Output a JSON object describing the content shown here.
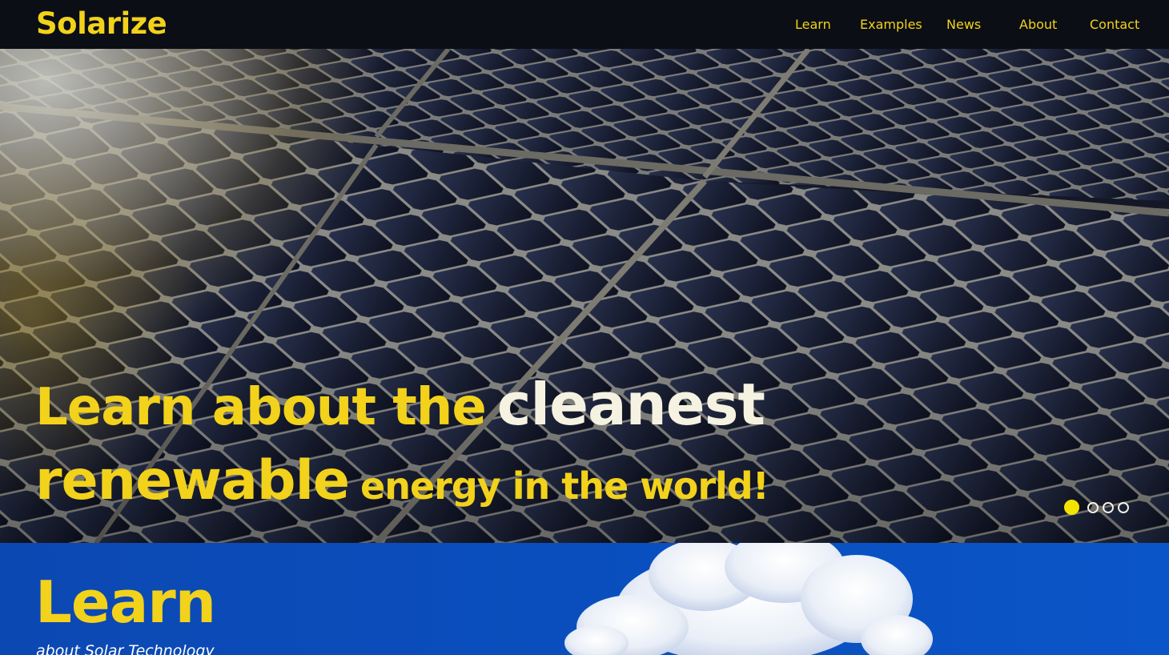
{
  "nav": {
    "logo": "Solarize",
    "links": [
      "Learn",
      "Examples",
      "News",
      "About",
      "Contact"
    ]
  },
  "hero": {
    "line1_a": "Learn about the",
    "line1_b": "cleanest",
    "line2_a": "renewable",
    "line2_b": "energy in the world!",
    "slides_total": 4,
    "active_slide": 1
  },
  "learn": {
    "title": "Learn",
    "subtitle": "about Solar Technology"
  },
  "colors": {
    "accent": "#f2d21b",
    "nav_bg": "#0b0e15",
    "section_blue": "#0a4fbf",
    "headline_white": "#f5f2e2"
  },
  "icons": [
    "carousel-dot-icon"
  ]
}
